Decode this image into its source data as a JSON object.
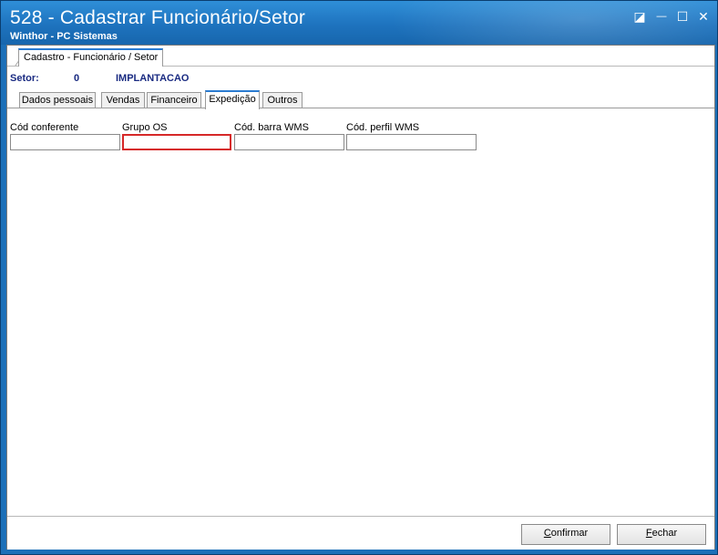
{
  "window": {
    "title": "528 - Cadastrar Funcionário/Setor",
    "subtitle": "Winthor - PC Sistemas",
    "controls": {
      "restore": "◪",
      "minimize": "—",
      "maximize": "☐",
      "close": "✕"
    }
  },
  "frame_tab": {
    "label": "Cadastro - Funcionário / Setor"
  },
  "setor": {
    "label": "Setor:",
    "code": "0",
    "name": "IMPLANTACAO"
  },
  "tabs": [
    "Dados pessoais",
    "Vendas",
    "Financeiro",
    "Expedição",
    "Outros"
  ],
  "active_tab": "Expedição",
  "fields": [
    {
      "label": "Cód conferente",
      "value": ""
    },
    {
      "label": "Grupo OS",
      "value": ""
    },
    {
      "label": "Cód. barra WMS",
      "value": ""
    },
    {
      "label": "Cód. perfil WMS",
      "value": ""
    }
  ],
  "buttons": {
    "confirm": {
      "accel": "C",
      "rest": "onfirmar"
    },
    "close": {
      "accel": "F",
      "rest": "echar"
    }
  },
  "colors": {
    "titlebar": "#1e73be",
    "active_tab_accent": "#2b7bd0",
    "focus_border": "#d62828",
    "setor_text": "#1a2b82"
  }
}
